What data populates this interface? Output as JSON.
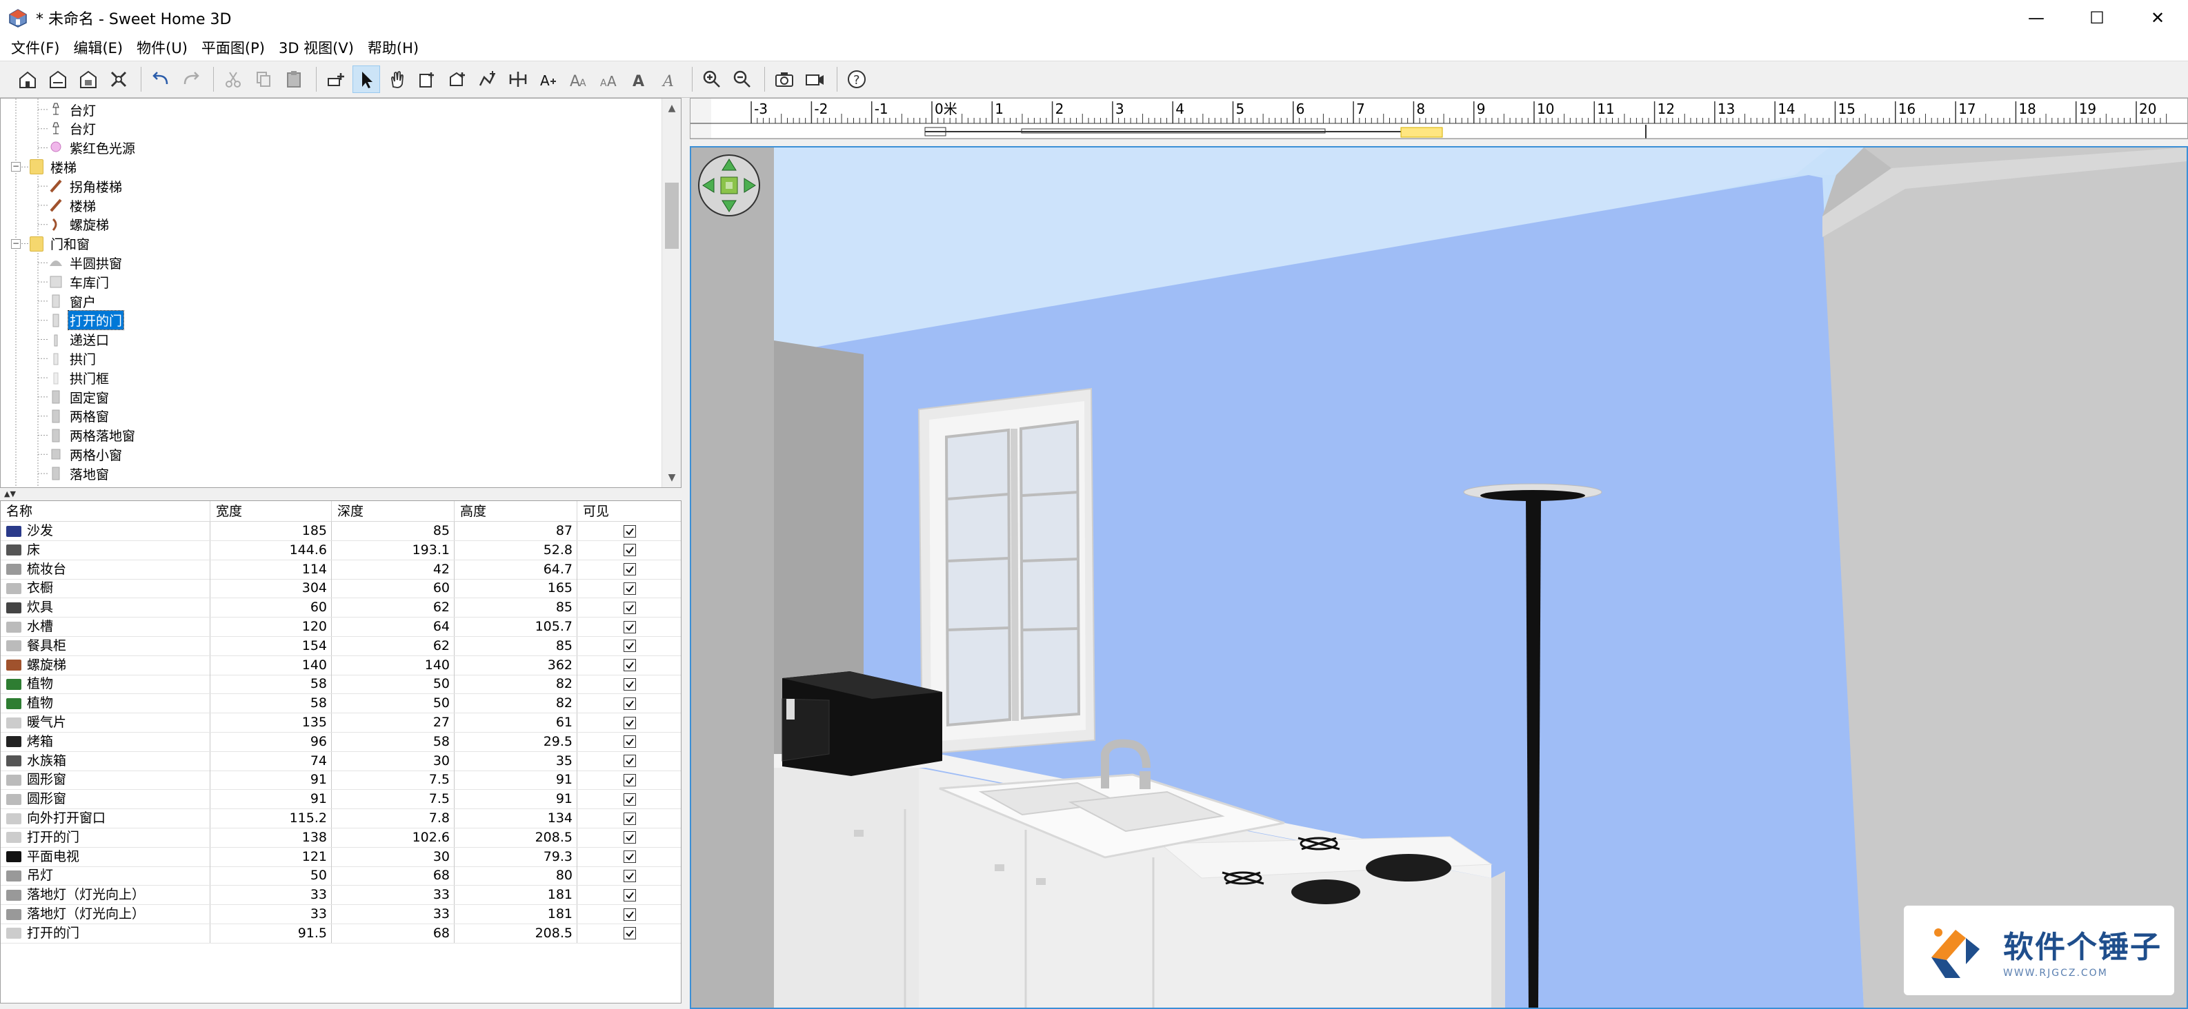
{
  "window": {
    "title": "* 未命名 - Sweet Home 3D",
    "minimize": "—",
    "maximize": "☐",
    "close": "✕"
  },
  "menu": [
    {
      "label": "文件(F)"
    },
    {
      "label": "编辑(E)"
    },
    {
      "label": "物件(U)"
    },
    {
      "label": "平面图(P)"
    },
    {
      "label": "3D 视图(V)"
    },
    {
      "label": "帮助(H)"
    }
  ],
  "toolbar": [
    "new-home-icon",
    "open-icon",
    "save-icon",
    "preferences-icon",
    "sep",
    "undo-icon",
    "redo-icon",
    "sep",
    "cut-icon",
    "copy-icon",
    "paste-icon",
    "sep",
    "add-furniture-icon",
    "select-icon",
    "pan-icon",
    "create-walls-icon",
    "create-rooms-icon",
    "create-polylines-icon",
    "create-dimensions-icon",
    "add-text-icon",
    "increase-text-icon",
    "decrease-text-icon",
    "bold-text-icon",
    "italic-text-icon",
    "sep",
    "zoom-in-icon",
    "zoom-out-icon",
    "sep",
    "photo-icon",
    "video-icon",
    "sep",
    "help-icon"
  ],
  "catalog": {
    "items": [
      {
        "label": "台灯",
        "level": 2,
        "icon": "lamp-icon"
      },
      {
        "label": "台灯",
        "level": 2,
        "icon": "lamp-icon"
      },
      {
        "label": "紫红色光源",
        "level": 2,
        "icon": "light-source-icon"
      },
      {
        "label": "楼梯",
        "level": 1,
        "icon": "folder-icon"
      },
      {
        "label": "拐角楼梯",
        "level": 2,
        "icon": "stairs-icon"
      },
      {
        "label": "楼梯",
        "level": 2,
        "icon": "stairs-icon"
      },
      {
        "label": "螺旋梯",
        "level": 2,
        "icon": "spiral-stairs-icon"
      },
      {
        "label": "门和窗",
        "level": 1,
        "icon": "folder-icon"
      },
      {
        "label": "半圆拱窗",
        "level": 2,
        "icon": "half-round-window-icon"
      },
      {
        "label": "车库门",
        "level": 2,
        "icon": "garage-door-icon"
      },
      {
        "label": "窗户",
        "level": 2,
        "icon": "window-icon"
      },
      {
        "label": "打开的门",
        "level": 2,
        "icon": "open-door-icon",
        "selected": true
      },
      {
        "label": "递送口",
        "level": 2,
        "icon": "service-hatch-icon"
      },
      {
        "label": "拱门",
        "level": 2,
        "icon": "arched-door-icon"
      },
      {
        "label": "拱门框",
        "level": 2,
        "icon": "arch-frame-icon"
      },
      {
        "label": "固定窗",
        "level": 2,
        "icon": "fixed-window-icon"
      },
      {
        "label": "两格窗",
        "level": 2,
        "icon": "double-window-icon"
      },
      {
        "label": "两格落地窗",
        "level": 2,
        "icon": "double-french-window-icon"
      },
      {
        "label": "两格小窗",
        "level": 2,
        "icon": "small-double-window-icon"
      },
      {
        "label": "落地窗",
        "level": 2,
        "icon": "french-window-icon"
      }
    ]
  },
  "furniture_table": {
    "headers": [
      "名称",
      "宽度",
      "深度",
      "高度",
      "可见"
    ],
    "rows": [
      {
        "name": "沙发",
        "w": "185",
        "d": "85",
        "h": "87",
        "icon": "sofa-icon",
        "icolor": "#2a3a8a"
      },
      {
        "name": "床",
        "w": "144.6",
        "d": "193.1",
        "h": "52.8",
        "icon": "bed-icon",
        "icolor": "#555"
      },
      {
        "name": "梳妆台",
        "w": "114",
        "d": "42",
        "h": "64.7",
        "icon": "dresser-icon",
        "icolor": "#999"
      },
      {
        "name": "衣橱",
        "w": "304",
        "d": "60",
        "h": "165",
        "icon": "wardrobe-icon",
        "icolor": "#bbb"
      },
      {
        "name": "炊具",
        "w": "60",
        "d": "62",
        "h": "85",
        "icon": "cooker-icon",
        "icolor": "#444"
      },
      {
        "name": "水槽",
        "w": "120",
        "d": "64",
        "h": "105.7",
        "icon": "sink-icon",
        "icolor": "#bbb"
      },
      {
        "name": "餐具柜",
        "w": "154",
        "d": "62",
        "h": "85",
        "icon": "cupboard-icon",
        "icolor": "#bbb"
      },
      {
        "name": "螺旋梯",
        "w": "140",
        "d": "140",
        "h": "362",
        "icon": "spiral-stairs-icon",
        "icolor": "#a0522d"
      },
      {
        "name": "植物",
        "w": "58",
        "d": "50",
        "h": "82",
        "icon": "plant-icon",
        "icolor": "#2e7d32"
      },
      {
        "name": "植物",
        "w": "58",
        "d": "50",
        "h": "82",
        "icon": "plant-icon",
        "icolor": "#2e7d32"
      },
      {
        "name": "暖气片",
        "w": "135",
        "d": "27",
        "h": "61",
        "icon": "radiator-icon",
        "icolor": "#ccc"
      },
      {
        "name": "烤箱",
        "w": "96",
        "d": "58",
        "h": "29.5",
        "icon": "oven-icon",
        "icolor": "#222"
      },
      {
        "name": "水族箱",
        "w": "74",
        "d": "30",
        "h": "35",
        "icon": "aquarium-icon",
        "icolor": "#555"
      },
      {
        "name": "圆形窗",
        "w": "91",
        "d": "7.5",
        "h": "91",
        "icon": "round-window-icon",
        "icolor": "#bbb"
      },
      {
        "name": "圆形窗",
        "w": "91",
        "d": "7.5",
        "h": "91",
        "icon": "round-window-icon",
        "icolor": "#bbb"
      },
      {
        "name": "向外打开窗口",
        "w": "115.2",
        "d": "7.8",
        "h": "134",
        "icon": "window-icon",
        "icolor": "#ccc"
      },
      {
        "name": "打开的门",
        "w": "138",
        "d": "102.6",
        "h": "208.5",
        "icon": "open-door-icon",
        "icolor": "#ccc"
      },
      {
        "name": "平面电视",
        "w": "121",
        "d": "30",
        "h": "79.3",
        "icon": "tv-icon",
        "icolor": "#111"
      },
      {
        "name": "吊灯",
        "w": "50",
        "d": "68",
        "h": "80",
        "icon": "pendant-lamp-icon",
        "icolor": "#999"
      },
      {
        "name": "落地灯（灯光向上）",
        "w": "33",
        "d": "33",
        "h": "181",
        "icon": "floor-lamp-icon",
        "icolor": "#999"
      },
      {
        "name": "落地灯（灯光向上）",
        "w": "33",
        "d": "33",
        "h": "181",
        "icon": "floor-lamp-icon",
        "icolor": "#999"
      },
      {
        "name": "打开的门",
        "w": "91.5",
        "d": "68",
        "h": "208.5",
        "icon": "open-door-icon",
        "icolor": "#ccc"
      }
    ]
  },
  "ruler": {
    "zero_label": "0米",
    "labels": [
      "-3",
      "-2",
      "-1",
      "1",
      "2",
      "3",
      "4",
      "5",
      "6",
      "7",
      "8",
      "9",
      "10",
      "11",
      "12",
      "13",
      "14",
      "15",
      "16",
      "17",
      "18",
      "19",
      "20"
    ]
  },
  "watermark": {
    "main": "软件个锤子",
    "sub": "WWW.RJGCZ.COM"
  }
}
